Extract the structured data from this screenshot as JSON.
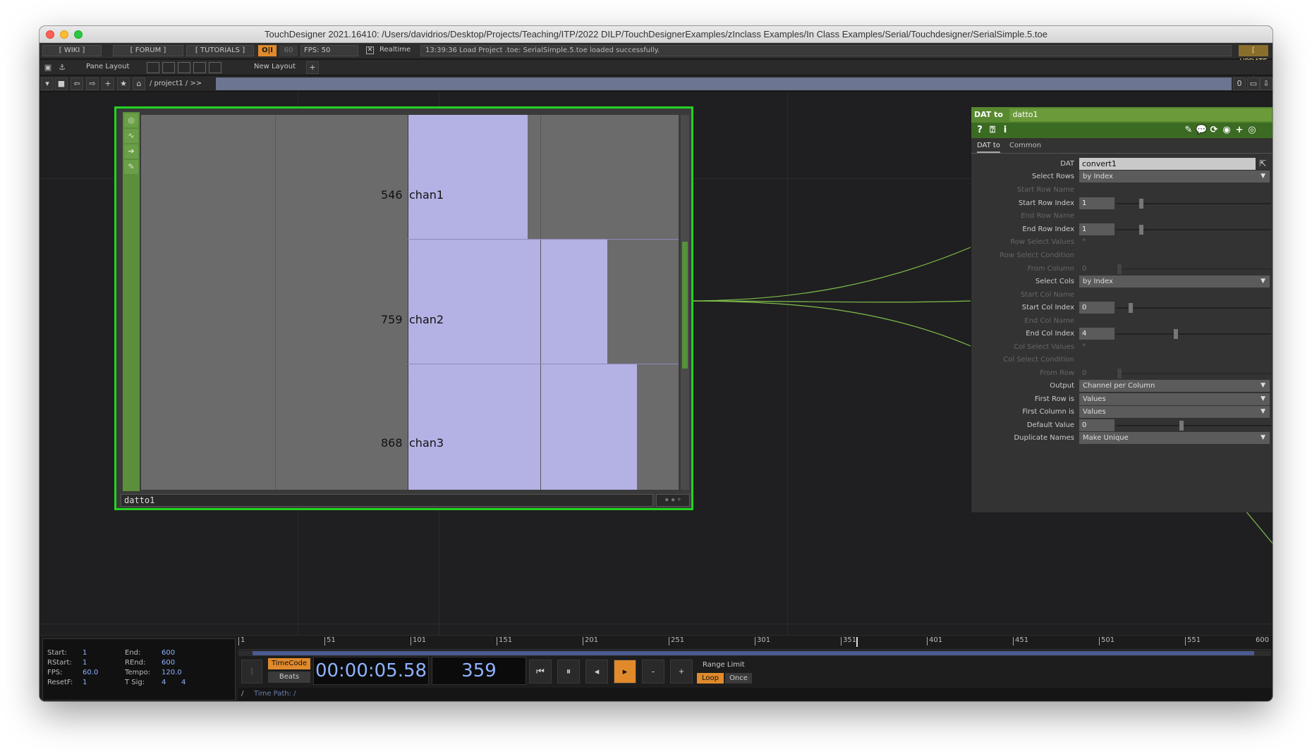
{
  "window": {
    "title": "TouchDesigner 2021.16410: /Users/davidrios/Desktop/Projects/Teaching/ITP/2022 DILP/TouchDesignerExamples/zInclass Examples/In Class Examples/Serial/Touchdesigner/SerialSimple.5.toe"
  },
  "topbar": {
    "wiki": "[ WIKI ]",
    "forum": "[ FORUM ]",
    "tutorials": "[ TUTORIALS ]",
    "oi": "O|I",
    "fps60": "60",
    "fps": "FPS:  50",
    "realtime_check": "✕",
    "realtime": "Realtime",
    "status": "13:39:36 Load Project .toe: SerialSimple.5.toe loaded successfully.",
    "update": "[ UPDATE ]"
  },
  "layoutbar": {
    "pane_layout": "Pane Layout",
    "new_layout": "New Layout",
    "plus": "+"
  },
  "pathbar": {
    "path": "/  project1  /  >>",
    "counter": "0"
  },
  "node": {
    "name": "datto1",
    "channels": [
      {
        "label": "chan1",
        "value": "546"
      },
      {
        "label": "chan2",
        "value": "759"
      },
      {
        "label": "chan3",
        "value": "868"
      }
    ]
  },
  "params": {
    "op_type": "DAT to",
    "op_name": "datto1",
    "tabs": [
      "DAT to",
      "Common"
    ],
    "rows": {
      "dat": {
        "label": "DAT",
        "value": "convert1"
      },
      "select_rows": {
        "label": "Select Rows",
        "value": "by Index"
      },
      "start_row_name": {
        "label": "Start Row Name"
      },
      "start_row_index": {
        "label": "Start Row Index",
        "value": "1"
      },
      "end_row_name": {
        "label": "End Row  Name"
      },
      "end_row_index": {
        "label": "End Row Index",
        "value": "1"
      },
      "row_select_values": {
        "label": "Row Select Values",
        "value": "*"
      },
      "row_select_condition": {
        "label": "Row Select Condition"
      },
      "from_column": {
        "label": "From Column",
        "value": "0"
      },
      "select_cols": {
        "label": "Select Cols",
        "value": "by Index"
      },
      "start_col_name": {
        "label": "Start Col Name"
      },
      "start_col_index": {
        "label": "Start Col Index",
        "value": "0"
      },
      "end_col_name": {
        "label": "End Col Name"
      },
      "end_col_index": {
        "label": "End Col Index",
        "value": "4"
      },
      "col_select_values": {
        "label": "Col Select Values",
        "value": "*"
      },
      "col_select_condition": {
        "label": "Col Select Condition"
      },
      "from_row": {
        "label": "From Row",
        "value": "0"
      },
      "output": {
        "label": "Output",
        "value": "Channel per Column"
      },
      "first_row_is": {
        "label": "First Row is",
        "value": "Values"
      },
      "first_column_is": {
        "label": "First Column is",
        "value": "Values"
      },
      "default_value": {
        "label": "Default Value",
        "value": "0"
      },
      "duplicate_names": {
        "label": "Duplicate Names",
        "value": "Make Unique"
      }
    }
  },
  "timeline": {
    "info": {
      "start_label": "Start:",
      "start": "1",
      "end_label": "End:",
      "end": "600",
      "rstart_label": "RStart:",
      "rstart": "1",
      "rend_label": "REnd:",
      "rend": "600",
      "fps_label": "FPS:",
      "fps": "60.0",
      "tempo_label": "Tempo:",
      "tempo": "120.0",
      "resetf_label": "ResetF:",
      "resetf": "1",
      "tsig_label": "T Sig:",
      "tsig_a": "4",
      "tsig_b": "4"
    },
    "ticks": [
      "1",
      "51",
      "101",
      "151",
      "201",
      "251",
      "301",
      "351",
      "401",
      "451",
      "501",
      "551",
      "600"
    ],
    "timecode_btn": "TimeCode",
    "beats_btn": "Beats",
    "timecode": "00:00:05.58",
    "frame": "359",
    "range_limit": "Range Limit",
    "loop": "Loop",
    "once": "Once",
    "time_path": "Time Path: /",
    "root": "/"
  }
}
